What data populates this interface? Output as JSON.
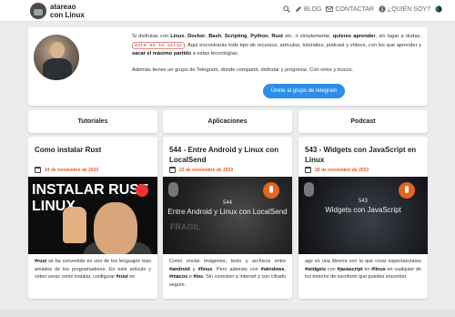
{
  "header": {
    "brand_line1": "atareao",
    "brand_line2": "con Linux",
    "nav": {
      "blog": "BLOG",
      "contact": "CONTACTAR",
      "about": "¿QUIÉN SOY?"
    }
  },
  "hero": {
    "p1_a": "Si disfrutas con ",
    "p1_b1": "Linux",
    "p1_c": ", ",
    "p1_b2": "Docker",
    "p1_d": ", ",
    "p1_b3": "Bash",
    "p1_e": ", ",
    "p1_b4": "Scripting",
    "p1_f": ", ",
    "p1_b5": "Python",
    "p1_g": ", ",
    "p1_b6": "Rust",
    "p1_h": " etc. o ",
    "p1_i": "simplemente",
    "p1_j": ", ",
    "p1_b7": "quieres aprender",
    "p1_k": ", sin lugar a dudas, ",
    "p1_code": "este es tu sitio",
    "p1_l": ". Aquí encontrarás todo tipo de recursos, artículos, tutoriales, podcast y vídeos, con los que aprender y ",
    "p1_b8": "sacar el máximo partido",
    "p1_m": " a estas tecnologías.",
    "p2": "Además tienes un grupo de Telegram, donde compartir, disfrutar y progresar. Con retos y trucos.",
    "telegram_button": "Únete al grupo de telegram"
  },
  "categories": [
    "Tutoriales",
    "Aplicaciones",
    "Podcast"
  ],
  "posts": [
    {
      "title": "Como instalar Rust",
      "date": "24 de noviembre de 2023",
      "thumb_text_1": "INSTALAR RUST",
      "thumb_text_2": "LINUX",
      "excerpt_1": "#rust",
      "excerpt_2": " se ha convertido en uno de los lenguajes mas amados de los programadores. En este artículo y vídeo verás como instalar, configurar ",
      "excerpt_3": "#rust",
      "excerpt_4": " en"
    },
    {
      "title": "544 - Entre Android y Linux con LocalSend",
      "date": "23 de noviembre de 2023",
      "thumb_num": "544",
      "thumb_text": "Entre Android y Linux con LocalSend",
      "thumb_faded": "FRAGIL",
      "excerpt_1": "Como enviar imágenes, texto y archivos entre ",
      "excerpt_2": "#android",
      "excerpt_3": " y ",
      "excerpt_4": "#linux",
      "excerpt_5": ". Pero además con ",
      "excerpt_6": "#windows",
      "excerpt_7": ", ",
      "excerpt_8": "#macos",
      "excerpt_9": " e ",
      "excerpt_10": "#ios",
      "excerpt_11": ". Sin conexión a internet y con cifrado seguro."
    },
    {
      "title": "543 - Widgets con JavaScript en Linux",
      "date": "20 de noviembre de 2023",
      "thumb_num": "543",
      "thumb_text": "Widgets con JavaScript",
      "excerpt_1": "ags es una librería con la que crear espectaculares ",
      "excerpt_2": "#widgets",
      "excerpt_3": " con ",
      "excerpt_4": "#javascript",
      "excerpt_5": " en ",
      "excerpt_6": "#linux",
      "excerpt_7": " en cualquier de los entorno de escritorio que puedes encontrar"
    }
  ],
  "colors": {
    "accent": "#2d8ee8",
    "date": "#e4572e",
    "background": "#ececec"
  }
}
